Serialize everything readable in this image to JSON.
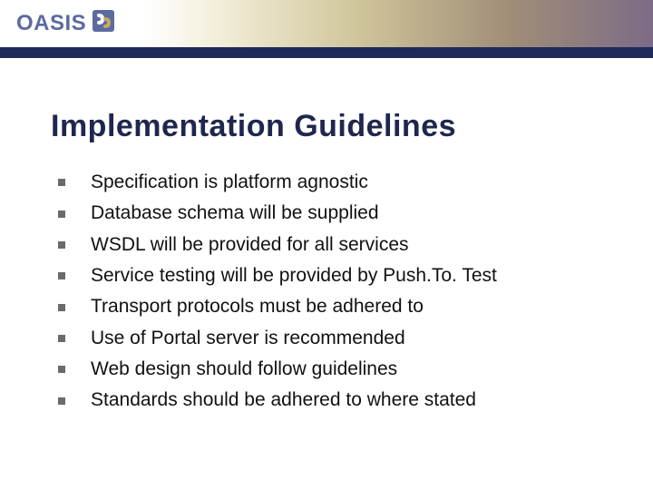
{
  "logo": {
    "text": "OASIS"
  },
  "title": "Implementation Guidelines",
  "bullets": [
    {
      "text": "Specification is platform agnostic"
    },
    {
      "text": "Database schema will be supplied"
    },
    {
      "text": "WSDL will be provided for all services"
    },
    {
      "text": "Service testing will be provided by Push.To. Test"
    },
    {
      "text": "Transport protocols must be adhered to"
    },
    {
      "text": "Use of Portal server is recommended"
    },
    {
      "text": "Web design should follow guidelines"
    },
    {
      "text": "Standards should be adhered to where stated"
    }
  ]
}
